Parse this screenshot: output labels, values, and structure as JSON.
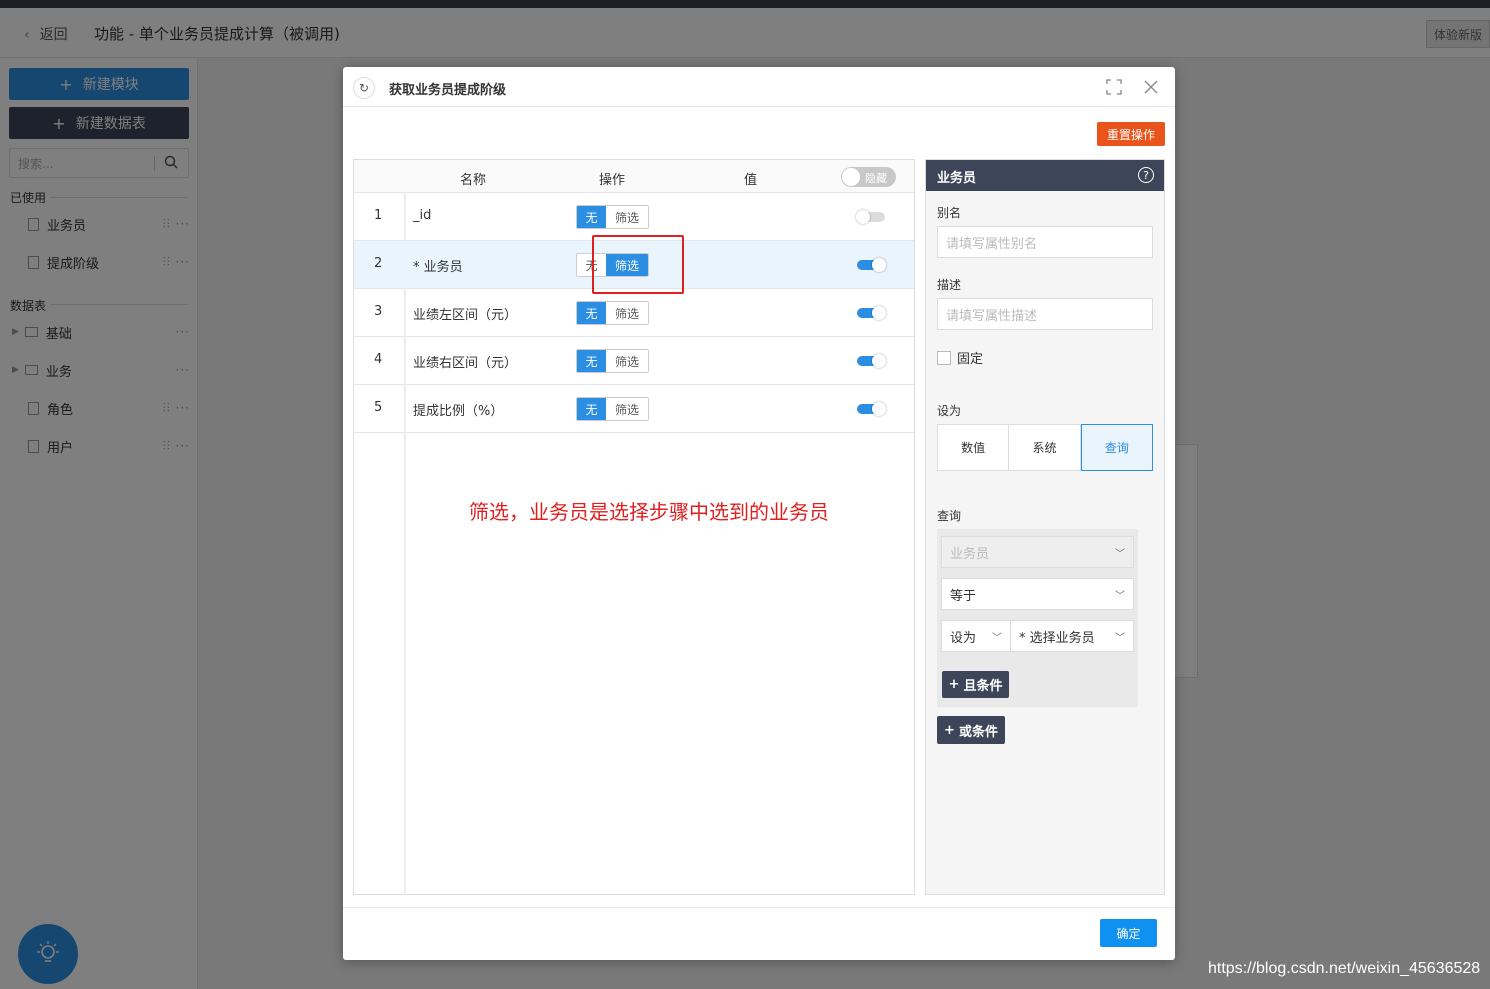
{
  "app": {
    "back_label": "返回",
    "page_title": "功能 - 单个业务员提成计算（被调用)",
    "trial_label": "体验新版"
  },
  "sidebar": {
    "new_module": "新建模块",
    "new_table": "新建数据表",
    "search_placeholder": "搜索...",
    "used_section": "已使用",
    "used_items": [
      {
        "label": "业务员"
      },
      {
        "label": "提成阶级"
      }
    ],
    "tables_section": "数据表",
    "table_items": [
      {
        "label": "基础"
      },
      {
        "label": "业务"
      },
      {
        "label": "角色"
      },
      {
        "label": "用户"
      }
    ]
  },
  "modal": {
    "title": "获取业务员提成阶级",
    "reset_label": "重置操作",
    "ok_label": "确定"
  },
  "table": {
    "headers": {
      "name": "名称",
      "op": "操作",
      "value": "值",
      "hide": "隐藏"
    },
    "seg_none": "无",
    "seg_filter": "筛选",
    "rows": [
      {
        "index": "1",
        "name": "_id",
        "op": "none",
        "toggle": "off"
      },
      {
        "index": "2",
        "name": "* 业务员",
        "op": "filter",
        "toggle": "on"
      },
      {
        "index": "3",
        "name": "业绩左区间（元）",
        "op": "none",
        "toggle": "on"
      },
      {
        "index": "4",
        "name": "业绩右区间（元）",
        "op": "none",
        "toggle": "on"
      },
      {
        "index": "5",
        "name": "提成比例（%）",
        "op": "none",
        "toggle": "on"
      }
    ],
    "annotation": "筛选，业务员是选择步骤中选到的业务员"
  },
  "props": {
    "title": "业务员",
    "help_icon": "?",
    "alias_label": "别名",
    "alias_placeholder": "请填写属性别名",
    "desc_label": "描述",
    "desc_placeholder": "请填写属性描述",
    "fixed_label": "固定",
    "setas_label": "设为",
    "setas_options": [
      "数值",
      "系统",
      "查询"
    ],
    "setas_active": "查询",
    "query_label": "查询",
    "query_field": "业务员",
    "query_op": "等于",
    "query_setas": "设为",
    "query_value": "* 选择业务员",
    "and_label": "且条件",
    "or_label": "或条件"
  },
  "watermark": "https://blog.csdn.net/weixin_45636528",
  "colors": {
    "primary": "#2b8ee3",
    "dark": "#3d4559",
    "danger": "#e9541c",
    "annotation": "#e02020"
  }
}
